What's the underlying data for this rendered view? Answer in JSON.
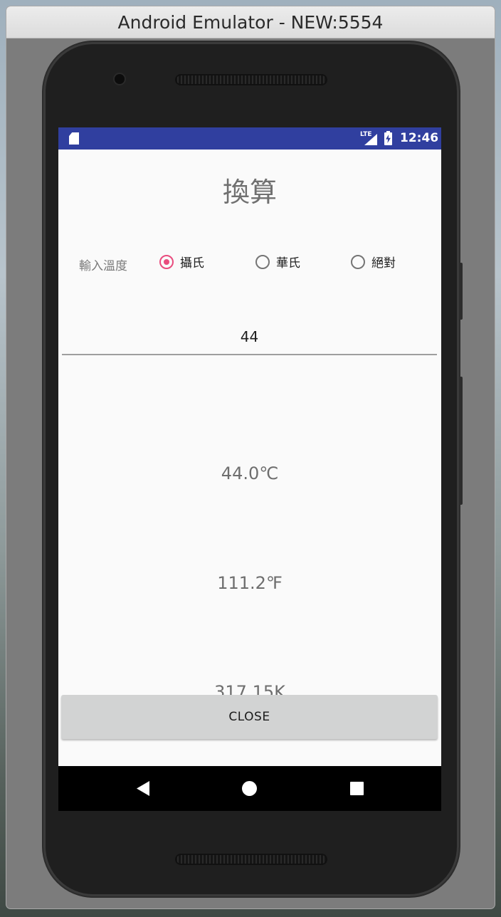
{
  "window": {
    "title": "Android Emulator - NEW:5554"
  },
  "status_bar": {
    "network": "LTE",
    "time": "12:46"
  },
  "app": {
    "title": "換算",
    "input_label": "輸入溫度",
    "unit_options": [
      {
        "label": "攝氏",
        "checked": true
      },
      {
        "label": "華氏",
        "checked": false
      },
      {
        "label": "絕對",
        "checked": false
      }
    ],
    "input_value": "44",
    "results": {
      "celsius": "44.0℃",
      "fahrenheit": "111.2℉",
      "kelvin": "317.15K"
    },
    "close_label": "CLOSE"
  },
  "colors": {
    "status_bar": "#303f9f",
    "accent": "#e94c7e",
    "button": "#d2d3d3"
  },
  "icons": {
    "status": [
      "sd-card-icon",
      "lte-signal-icon",
      "battery-charging-icon"
    ],
    "navigation": [
      "back-icon",
      "home-icon",
      "recents-icon"
    ]
  }
}
